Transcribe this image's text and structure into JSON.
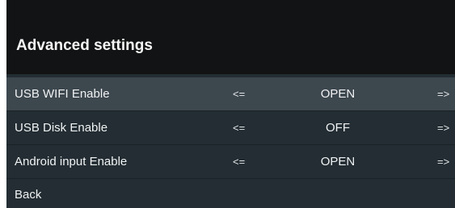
{
  "header": {
    "title": "Advanced settings"
  },
  "settings": [
    {
      "label": "USB WIFI Enable",
      "prev": "<=",
      "value": "OPEN",
      "next": "=>",
      "selected": true
    },
    {
      "label": "USB Disk Enable",
      "prev": "<=",
      "value": "OFF",
      "next": "=>",
      "selected": false
    },
    {
      "label": "Android input Enable",
      "prev": "<=",
      "value": "OPEN",
      "next": "=>",
      "selected": false
    }
  ],
  "back": {
    "label": "Back"
  },
  "colors": {
    "header_bg": "#121314",
    "panel_bg": "#232d33",
    "selected_row_bg": "#3d474e",
    "text": "#f0f2f3"
  }
}
